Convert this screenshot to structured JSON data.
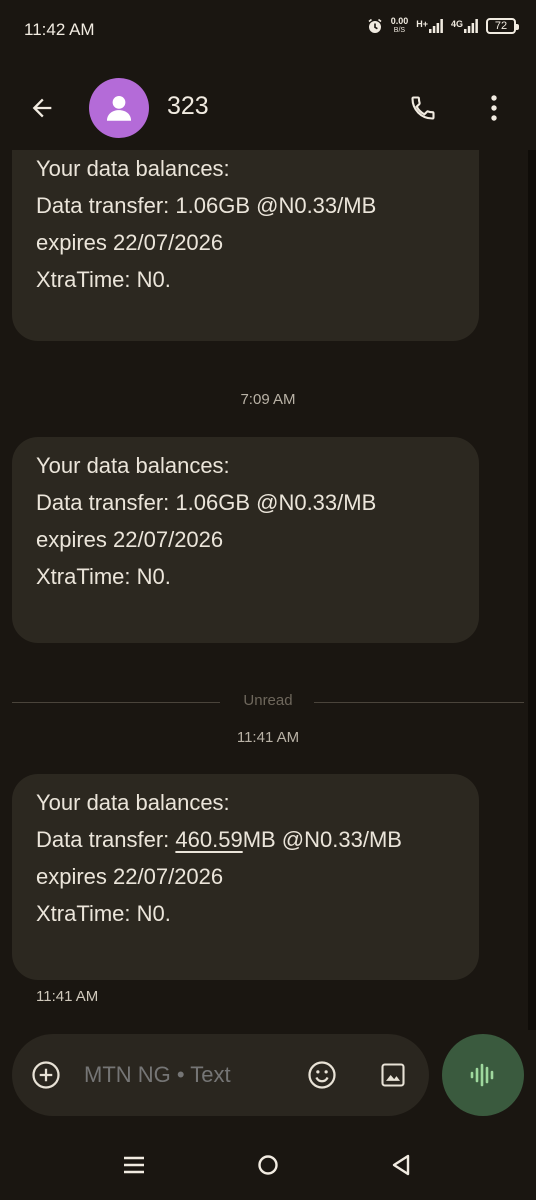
{
  "status_bar": {
    "time": "11:42 AM",
    "net_speed_value": "0.00",
    "net_speed_unit": "B/S",
    "network_1": "H+",
    "network_2": "4G",
    "battery": "72"
  },
  "header": {
    "contact_name": "323",
    "icons": [
      "back-arrow-icon",
      "person-icon",
      "phone-icon",
      "more-vert-icon"
    ],
    "avatar_color": "#b46bd8"
  },
  "messages": [
    {
      "lines": [
        "Your data balances:",
        "Data transfer: 1.06GB @N0.33/MB",
        "expires 22/07/2026",
        "XtraTime: N0."
      ]
    },
    {
      "lines": [
        "Your data balances:",
        "Data transfer: 1.06GB @N0.33/MB",
        "expires 22/07/2026",
        "XtraTime: N0."
      ]
    },
    {
      "line1": "Your data balances:",
      "line2_prefix": "Data transfer: ",
      "line2_number": "460.59",
      "line2_suffix": "MB @N0.33/MB",
      "line3": "expires 22/07/2026",
      "line4": "XtraTime: N0."
    }
  ],
  "timestamps": {
    "t1": "7:09 AM",
    "unread_label": "Unread",
    "t2": "11:41 AM",
    "last_message_time": "11:41 AM"
  },
  "compose": {
    "placeholder": "MTN NG • Text",
    "voice_button_color": "#3a5a3e"
  },
  "nav": {
    "icons": [
      "recents-icon",
      "home-icon",
      "back-triangle-icon"
    ]
  }
}
